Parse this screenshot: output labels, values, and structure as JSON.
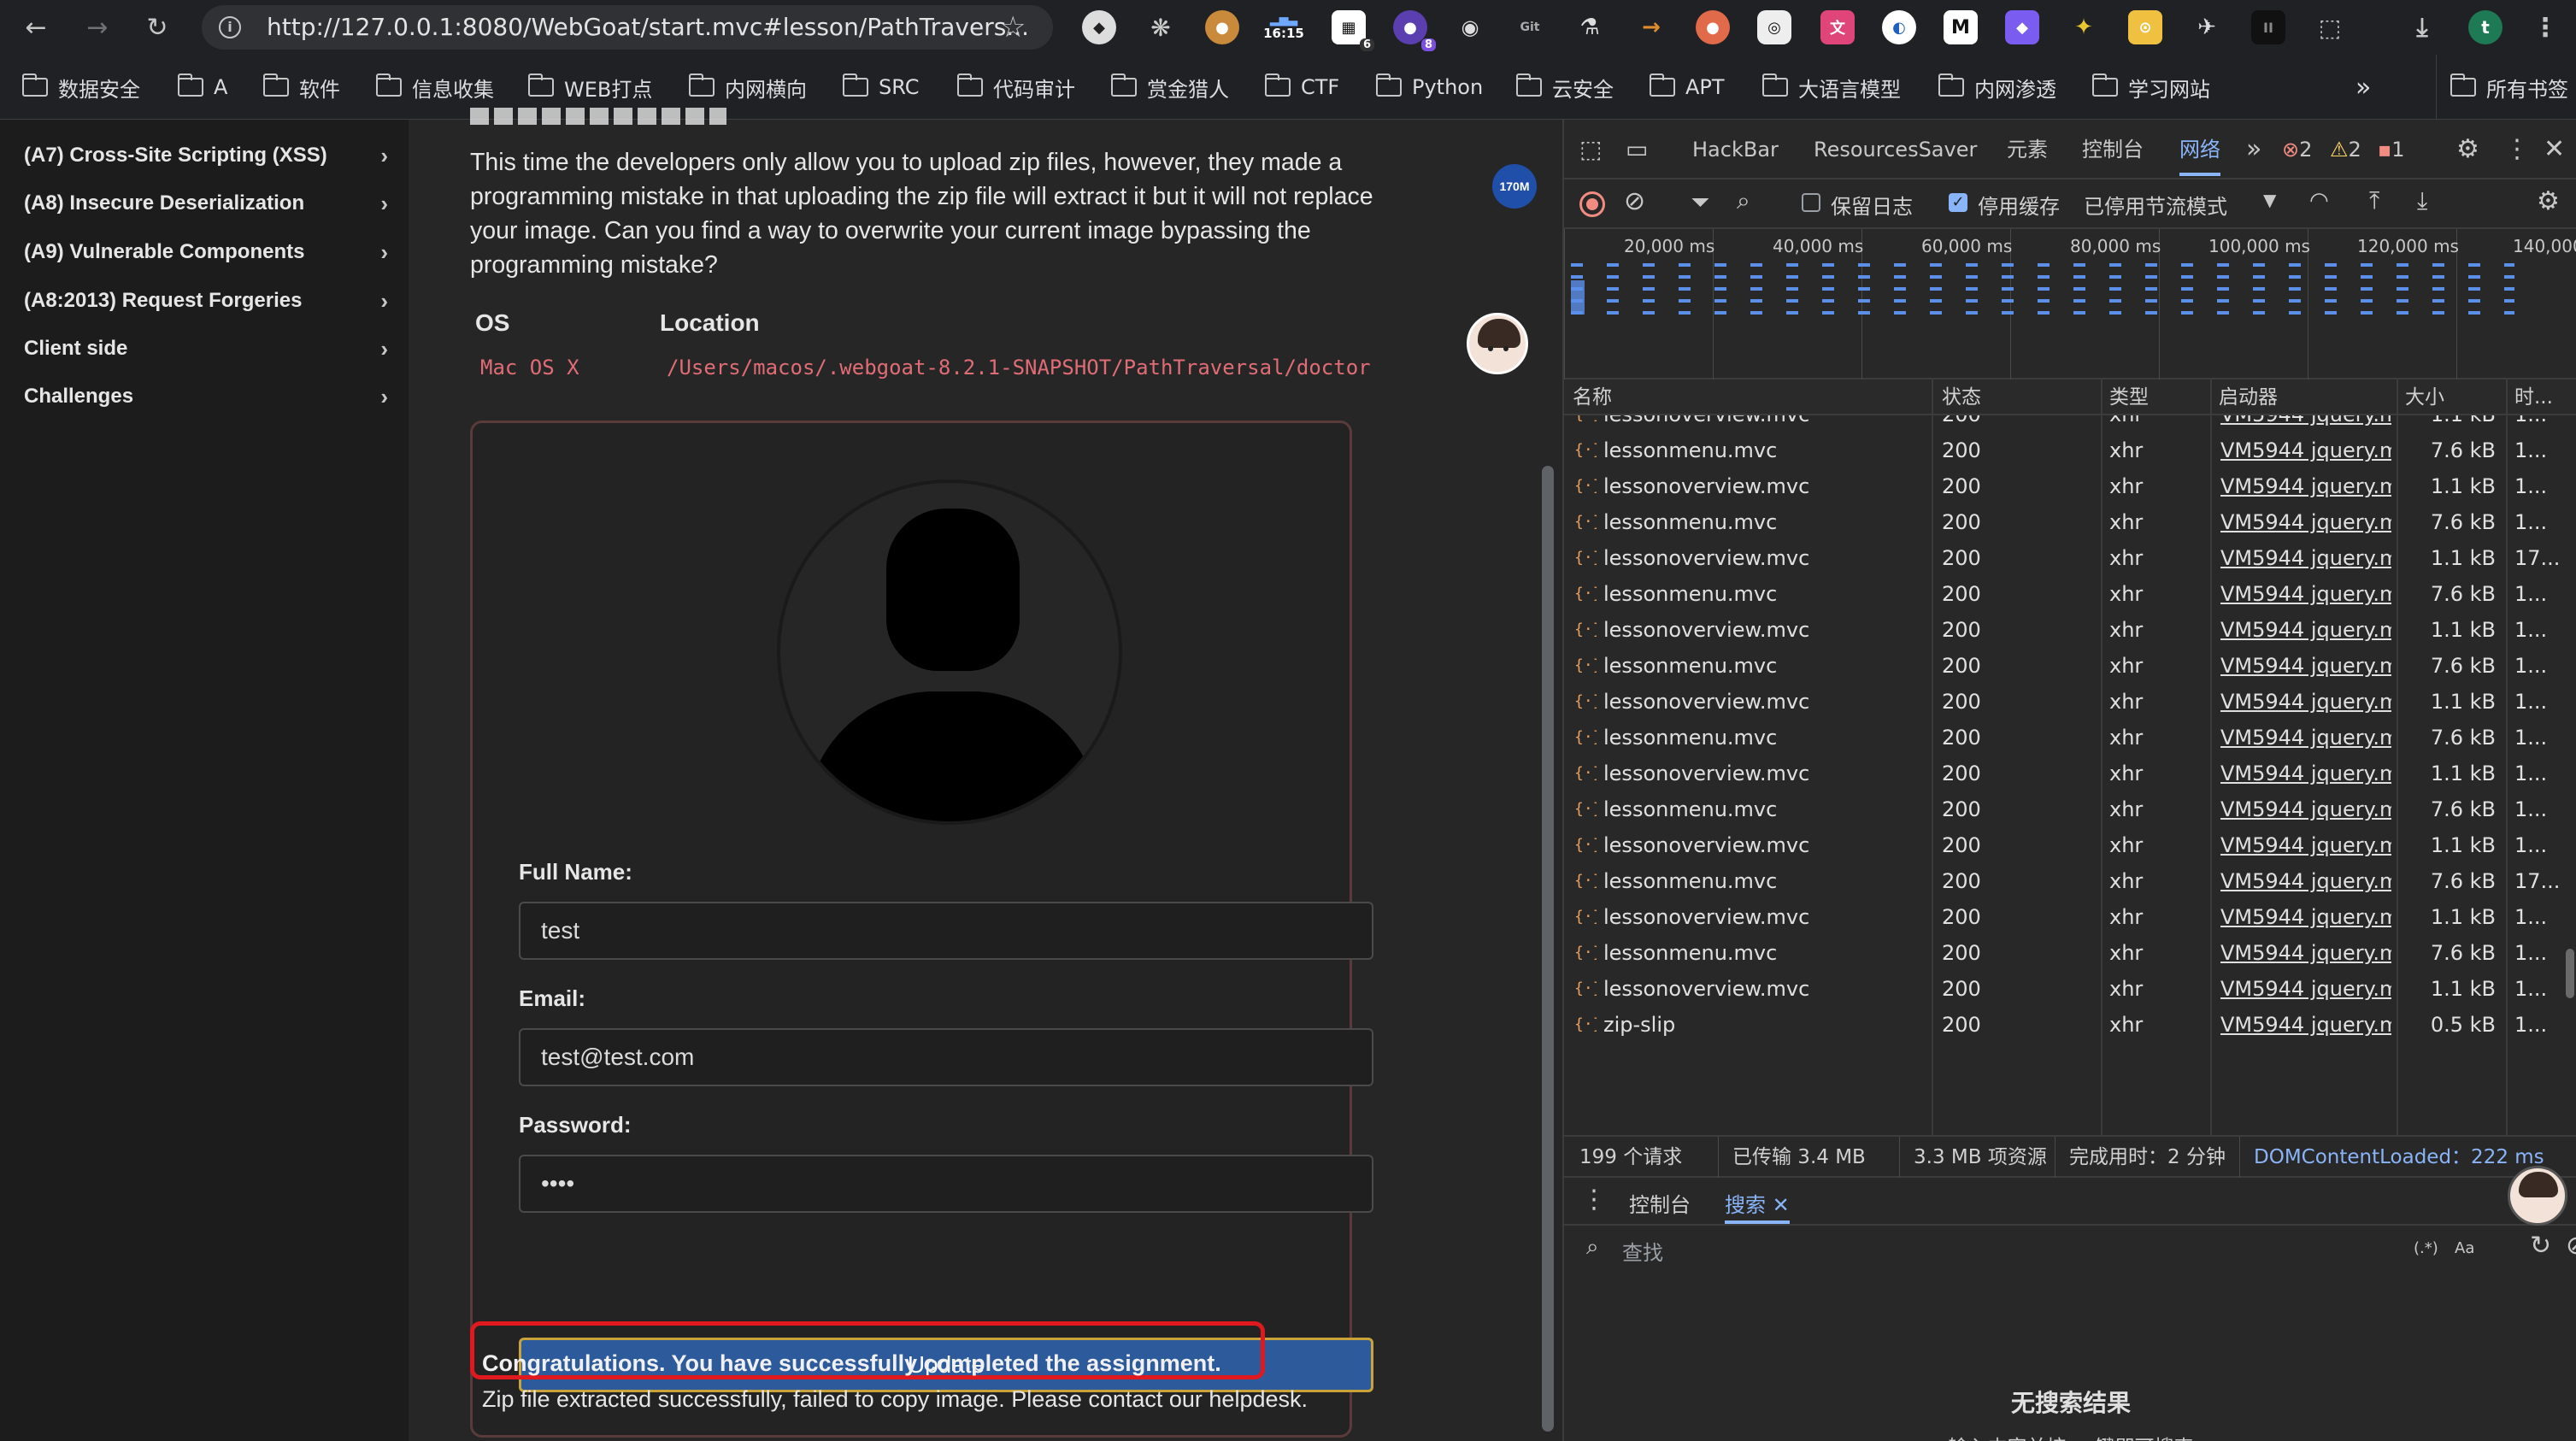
{
  "browser": {
    "url": "http://127.0.0.1:8080/WebGoat/start.mvc#lesson/PathTravers...",
    "clock_time": "16:15",
    "ext_badge_1": "6",
    "ext_badge_2": "8",
    "profile_initial": "t",
    "bookmarks": [
      "数据安全",
      "A",
      "软件",
      "信息收集",
      "WEB打点",
      "内网横向",
      "SRC",
      "代码审计",
      "赏金猎人",
      "CTF",
      "Python",
      "云安全",
      "APT",
      "大语言模型",
      "内网渗透",
      "学习网站"
    ],
    "bookmarks_more": "»",
    "all_bookmarks": "所有书签"
  },
  "sidebar": {
    "items": [
      {
        "label": "(A7) Cross-Site Scripting (XSS)"
      },
      {
        "label": "(A8) Insecure Deserialization"
      },
      {
        "label": "(A9) Vulnerable Components"
      },
      {
        "label": "(A8:2013) Request Forgeries"
      },
      {
        "label": "Client side"
      },
      {
        "label": "Challenges"
      }
    ]
  },
  "lesson": {
    "description": "This time the developers only allow you to upload zip files, however, they made a programming mistake in that uploading the zip file will extract it but it will not replace your image. Can you find a way to overwrite your current image bypassing the programming mistake?",
    "table_headers": {
      "os": "OS",
      "location": "Location"
    },
    "os_value": "Mac OS X",
    "location_value": "/Users/macos/.webgoat-8.2.1-SNAPSHOT/PathTraversal/doctor",
    "memory_badge": "170M",
    "form": {
      "fullname_label": "Full Name:",
      "fullname_value": "test",
      "email_label": "Email:",
      "email_value": "test@test.com",
      "password_label": "Password:",
      "password_value": "••••",
      "update_label": "Update"
    },
    "success_message": "Congratulations. You have successfully completed the assignment.",
    "feedback_message": "Zip file extracted successfully, failed to copy image. Please contact our helpdesk."
  },
  "devtools": {
    "tabs": [
      "HackBar",
      "ResourcesSaver",
      "元素",
      "控制台",
      "网络"
    ],
    "active_tab": "网络",
    "more_tabs": "»",
    "error_count": "2",
    "warning_count": "2",
    "info_count": "1",
    "toolbar": {
      "preserve_log": "保留日志",
      "disable_cache": "停用缓存",
      "throttle": "已停用节流模式"
    },
    "timeline_ticks": [
      "20,000 ms",
      "40,000 ms",
      "60,000 ms",
      "80,000 ms",
      "100,000 ms",
      "120,000 ms",
      "140,000"
    ],
    "columns": [
      "名称",
      "状态",
      "类型",
      "启动器",
      "大小",
      "时..."
    ],
    "rows": [
      {
        "name": "lessonoverview.mvc",
        "status": "200",
        "type": "xhr",
        "initiator": "VM5944 jquery.mi",
        "size": "1.1 kB",
        "time": "1..."
      },
      {
        "name": "lessonmenu.mvc",
        "status": "200",
        "type": "xhr",
        "initiator": "VM5944 jquery.mi",
        "size": "7.6 kB",
        "time": "1..."
      },
      {
        "name": "lessonoverview.mvc",
        "status": "200",
        "type": "xhr",
        "initiator": "VM5944 jquery.mi",
        "size": "1.1 kB",
        "time": "1..."
      },
      {
        "name": "lessonmenu.mvc",
        "status": "200",
        "type": "xhr",
        "initiator": "VM5944 jquery.mi",
        "size": "7.6 kB",
        "time": "1..."
      },
      {
        "name": "lessonoverview.mvc",
        "status": "200",
        "type": "xhr",
        "initiator": "VM5944 jquery.mi",
        "size": "1.1 kB",
        "time": "17..."
      },
      {
        "name": "lessonmenu.mvc",
        "status": "200",
        "type": "xhr",
        "initiator": "VM5944 jquery.mi",
        "size": "7.6 kB",
        "time": "1..."
      },
      {
        "name": "lessonoverview.mvc",
        "status": "200",
        "type": "xhr",
        "initiator": "VM5944 jquery.mi",
        "size": "1.1 kB",
        "time": "1..."
      },
      {
        "name": "lessonmenu.mvc",
        "status": "200",
        "type": "xhr",
        "initiator": "VM5944 jquery.mi",
        "size": "7.6 kB",
        "time": "1..."
      },
      {
        "name": "lessonoverview.mvc",
        "status": "200",
        "type": "xhr",
        "initiator": "VM5944 jquery.mi",
        "size": "1.1 kB",
        "time": "1..."
      },
      {
        "name": "lessonmenu.mvc",
        "status": "200",
        "type": "xhr",
        "initiator": "VM5944 jquery.mi",
        "size": "7.6 kB",
        "time": "1..."
      },
      {
        "name": "lessonoverview.mvc",
        "status": "200",
        "type": "xhr",
        "initiator": "VM5944 jquery.mi",
        "size": "1.1 kB",
        "time": "1..."
      },
      {
        "name": "lessonmenu.mvc",
        "status": "200",
        "type": "xhr",
        "initiator": "VM5944 jquery.mi",
        "size": "7.6 kB",
        "time": "1..."
      },
      {
        "name": "lessonoverview.mvc",
        "status": "200",
        "type": "xhr",
        "initiator": "VM5944 jquery.mi",
        "size": "1.1 kB",
        "time": "1..."
      },
      {
        "name": "lessonmenu.mvc",
        "status": "200",
        "type": "xhr",
        "initiator": "VM5944 jquery.mi",
        "size": "7.6 kB",
        "time": "17..."
      },
      {
        "name": "lessonoverview.mvc",
        "status": "200",
        "type": "xhr",
        "initiator": "VM5944 jquery.mi",
        "size": "1.1 kB",
        "time": "1..."
      },
      {
        "name": "lessonmenu.mvc",
        "status": "200",
        "type": "xhr",
        "initiator": "VM5944 jquery.mi",
        "size": "7.6 kB",
        "time": "1..."
      },
      {
        "name": "lessonoverview.mvc",
        "status": "200",
        "type": "xhr",
        "initiator": "VM5944 jquery.mi",
        "size": "1.1 kB",
        "time": "1..."
      },
      {
        "name": "zip-slip",
        "status": "200",
        "type": "xhr",
        "initiator": "VM5944 jquery.mi",
        "size": "0.5 kB",
        "time": "1..."
      }
    ],
    "summary": {
      "requests": "199 个请求",
      "transferred": "已传输 3.4 MB",
      "resources": "3.3 MB 项资源",
      "finish": "完成用时：2 分钟",
      "dcl": "DOMContentLoaded：222 ms"
    },
    "drawer": {
      "console_tab": "控制台",
      "search_tab": "搜索",
      "search_placeholder": "查找",
      "regex_label": "(.*)",
      "case_label": "Aa",
      "no_results": "无搜索结果",
      "hint": "输入内容并按 ↩ 键即可搜索"
    }
  }
}
